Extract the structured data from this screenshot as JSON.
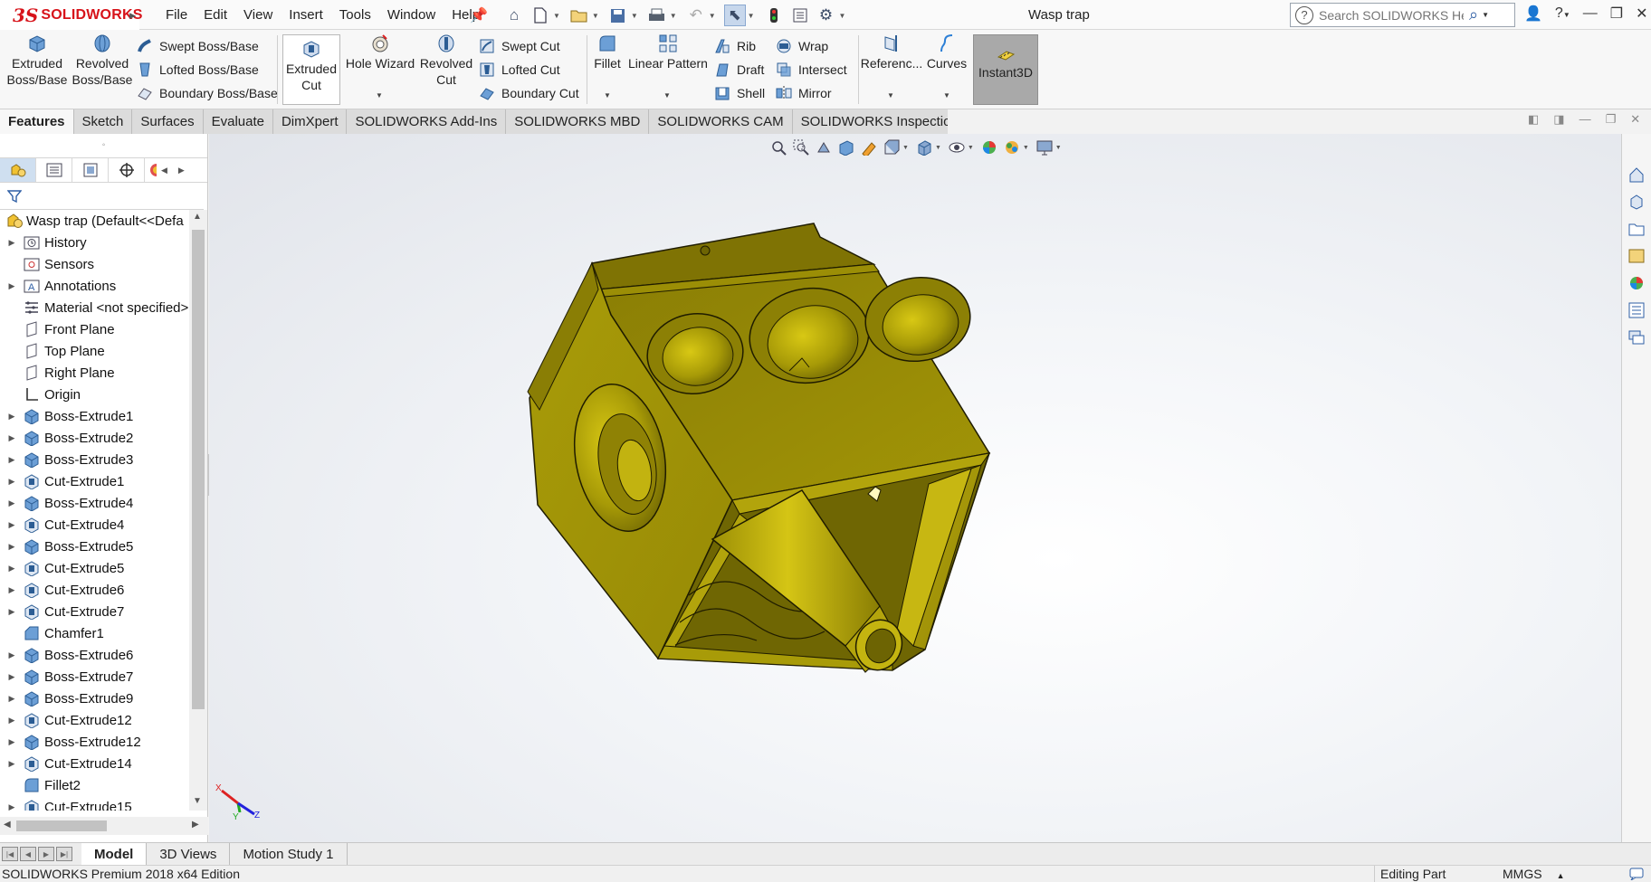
{
  "app": {
    "brand_ds": "3S",
    "brand_name": "SOLIDWORKS",
    "document_title": "Wasp trap"
  },
  "menu": [
    "File",
    "Edit",
    "View",
    "Insert",
    "Tools",
    "Window",
    "Help"
  ],
  "search": {
    "placeholder": "Search SOLIDWORKS Help"
  },
  "commands": {
    "extruded_boss_1": "Extruded",
    "extruded_boss_2": "Boss/Base",
    "revolved_boss_1": "Revolved",
    "revolved_boss_2": "Boss/Base",
    "swept_boss": "Swept Boss/Base",
    "lofted_boss": "Lofted Boss/Base",
    "boundary_boss": "Boundary Boss/Base",
    "extruded_cut_1": "Extruded",
    "extruded_cut_2": "Cut",
    "hole_wizard": "Hole Wizard",
    "revolved_cut_1": "Revolved",
    "revolved_cut_2": "Cut",
    "swept_cut": "Swept Cut",
    "lofted_cut": "Lofted Cut",
    "boundary_cut": "Boundary Cut",
    "fillet": "Fillet",
    "linear_pattern": "Linear Pattern",
    "rib": "Rib",
    "draft": "Draft",
    "shell": "Shell",
    "wrap": "Wrap",
    "intersect": "Intersect",
    "mirror": "Mirror",
    "reference": "Referenc...",
    "curves": "Curves",
    "instant3d": "Instant3D"
  },
  "tabs": [
    "Features",
    "Sketch",
    "Surfaces",
    "Evaluate",
    "DimXpert",
    "SOLIDWORKS Add-Ins",
    "SOLIDWORKS MBD",
    "SOLIDWORKS CAM",
    "SOLIDWORKS Inspection"
  ],
  "tree": {
    "root": "Wasp trap  (Default<<Defa",
    "items": [
      {
        "label": "History",
        "icon": "history-folder-icon",
        "expand": true
      },
      {
        "label": "Sensors",
        "icon": "sensors-icon",
        "expand": false
      },
      {
        "label": "Annotations",
        "icon": "annotations-icon",
        "expand": true
      },
      {
        "label": "Material <not specified>",
        "icon": "material-icon",
        "expand": false
      },
      {
        "label": "Front Plane",
        "icon": "plane-icon",
        "expand": false
      },
      {
        "label": "Top Plane",
        "icon": "plane-icon",
        "expand": false
      },
      {
        "label": "Right Plane",
        "icon": "plane-icon",
        "expand": false
      },
      {
        "label": "Origin",
        "icon": "origin-icon",
        "expand": false
      },
      {
        "label": "Boss-Extrude1",
        "icon": "boss-extrude-icon",
        "expand": true
      },
      {
        "label": "Boss-Extrude2",
        "icon": "boss-extrude-icon",
        "expand": true
      },
      {
        "label": "Boss-Extrude3",
        "icon": "boss-extrude-icon",
        "expand": true
      },
      {
        "label": "Cut-Extrude1",
        "icon": "cut-extrude-icon",
        "expand": true
      },
      {
        "label": "Boss-Extrude4",
        "icon": "boss-extrude-icon",
        "expand": true
      },
      {
        "label": "Cut-Extrude4",
        "icon": "cut-extrude-icon",
        "expand": true
      },
      {
        "label": "Boss-Extrude5",
        "icon": "boss-extrude-icon",
        "expand": true
      },
      {
        "label": "Cut-Extrude5",
        "icon": "cut-extrude-icon",
        "expand": true
      },
      {
        "label": "Cut-Extrude6",
        "icon": "cut-extrude-icon",
        "expand": true
      },
      {
        "label": "Cut-Extrude7",
        "icon": "cut-extrude-icon",
        "expand": true
      },
      {
        "label": "Chamfer1",
        "icon": "chamfer-icon",
        "expand": false
      },
      {
        "label": "Boss-Extrude6",
        "icon": "boss-extrude-icon",
        "expand": true
      },
      {
        "label": "Boss-Extrude7",
        "icon": "boss-extrude-icon",
        "expand": true
      },
      {
        "label": "Boss-Extrude9",
        "icon": "boss-extrude-icon",
        "expand": true
      },
      {
        "label": "Cut-Extrude12",
        "icon": "cut-extrude-icon",
        "expand": true
      },
      {
        "label": "Boss-Extrude12",
        "icon": "boss-extrude-icon",
        "expand": true
      },
      {
        "label": "Cut-Extrude14",
        "icon": "cut-extrude-icon",
        "expand": true
      },
      {
        "label": "Fillet2",
        "icon": "fillet-icon",
        "expand": false
      },
      {
        "label": "Cut-Extrude15",
        "icon": "cut-extrude-icon",
        "expand": true
      }
    ]
  },
  "bottom_tabs": [
    "Model",
    "3D Views",
    "Motion Study 1"
  ],
  "status": {
    "edition": "SOLIDWORKS Premium 2018 x64 Edition",
    "mode": "Editing Part",
    "units": "MMGS"
  },
  "colors": {
    "brand_red": "#d7131a",
    "model_gold": "#a89a0a",
    "accent_blue": "#2f6eb5"
  }
}
